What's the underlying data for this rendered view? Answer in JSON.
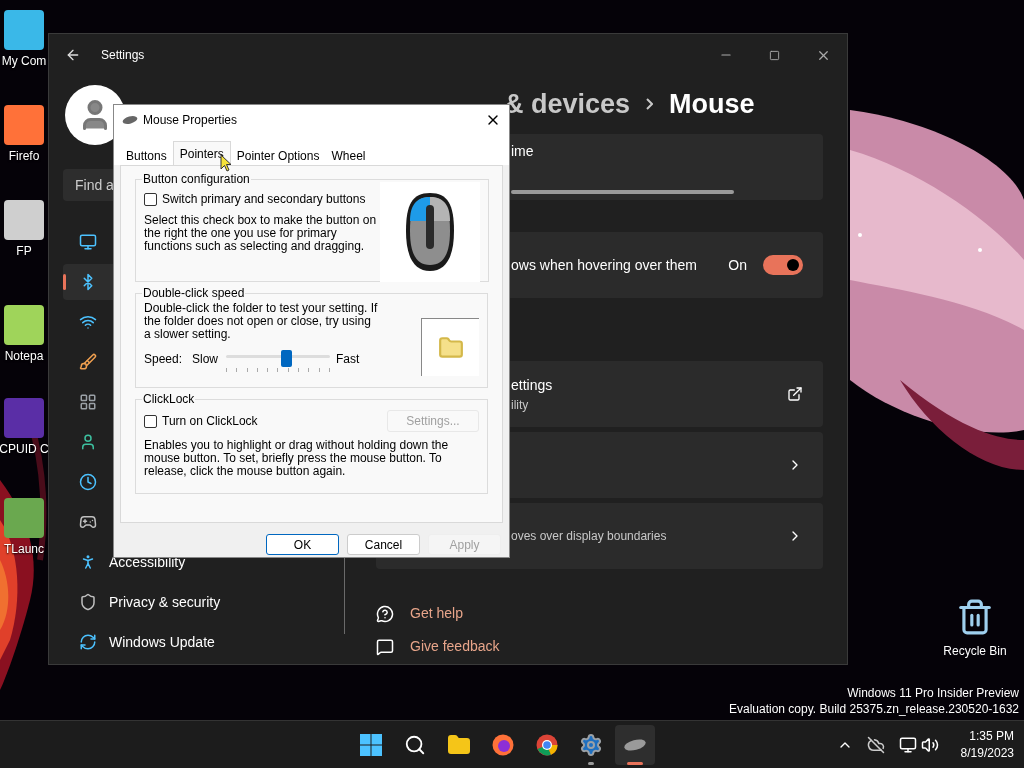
{
  "desktop": {
    "icons": [
      {
        "label": "My Com"
      },
      {
        "label": "Firefo"
      },
      {
        "label": "FP"
      },
      {
        "label": "Notepa"
      },
      {
        "label": "CPUID C"
      },
      {
        "label": "TLaunc"
      }
    ],
    "recycle_bin": {
      "label": "Recycle Bin"
    }
  },
  "settings": {
    "title": "Settings",
    "search": {
      "placeholder": "Find a"
    },
    "sidebar": {
      "items": [
        {
          "selected": false
        },
        {
          "selected": true
        },
        {
          "selected": false
        },
        {
          "selected": false
        },
        {
          "selected": false
        },
        {
          "selected": false
        },
        {
          "selected": false
        },
        {
          "selected": false
        },
        {
          "label": "Accessibility",
          "selected": false
        },
        {
          "label": "Privacy & security",
          "selected": false
        },
        {
          "label": "Windows Update",
          "selected": false
        }
      ]
    },
    "header": {
      "parent": "& devices",
      "current": "Mouse"
    },
    "cards": [
      {
        "kind": "slider",
        "title": "ime"
      },
      {
        "kind": "toggle",
        "title": "ows when hovering over them",
        "state": "On",
        "on": true
      },
      {
        "kind": "link",
        "title": "ettings",
        "subtitle": "ility"
      },
      {
        "kind": "nav"
      },
      {
        "kind": "nav",
        "subtitle": "oves over display boundaries"
      }
    ],
    "links": [
      "Get help",
      "Give feedback"
    ]
  },
  "dialog": {
    "title": "Mouse Properties",
    "tabs": [
      {
        "label": "Buttons",
        "selected": false
      },
      {
        "label": "Pointers",
        "selected": true
      },
      {
        "label": "Pointer Options",
        "selected": false
      },
      {
        "label": "Wheel",
        "selected": false
      }
    ],
    "button_configuration": {
      "title": "Button configuration",
      "checkbox": {
        "label": "Switch primary and secondary buttons",
        "checked": false
      },
      "description": "Select this check box to make the button on the right the one you use for primary functions such as selecting and dragging."
    },
    "double_click": {
      "title": "Double-click speed",
      "description": "Double-click the folder to test your setting. If the folder does not open or close, try using a slower setting.",
      "speed_label": "Speed:",
      "slow": "Slow",
      "fast": "Fast",
      "level": 0.58
    },
    "clicklock": {
      "title": "ClickLock",
      "checkbox": {
        "label": "Turn on ClickLock",
        "checked": false
      },
      "settings_button": {
        "label": "Settings...",
        "disabled": true
      },
      "description": "Enables you to highlight or drag without holding down the mouse button. To set, briefly press the mouse button. To release, click the mouse button again."
    },
    "buttons": [
      {
        "label": "OK",
        "kind": "default",
        "disabled": false
      },
      {
        "label": "Cancel",
        "kind": "normal",
        "disabled": false
      },
      {
        "label": "Apply",
        "kind": "normal",
        "disabled": true
      }
    ]
  },
  "watermark": [
    "Windows 11 Pro Insider Preview",
    "Evaluation copy. Build 25375.zn_release.230520-1632"
  ],
  "taskbar": {
    "apps": [
      {
        "kind": "start",
        "open": false,
        "selected": false
      },
      {
        "kind": "search",
        "open": false,
        "selected": false
      },
      {
        "kind": "explorer",
        "open": false,
        "selected": false
      },
      {
        "kind": "firefox",
        "open": false,
        "selected": false
      },
      {
        "kind": "chrome",
        "open": false,
        "selected": false
      },
      {
        "kind": "settings",
        "open": true,
        "selected": false
      },
      {
        "kind": "mouse",
        "open": true,
        "selected": true
      }
    ],
    "time": "1:35 PM",
    "date": "8/19/2023"
  }
}
